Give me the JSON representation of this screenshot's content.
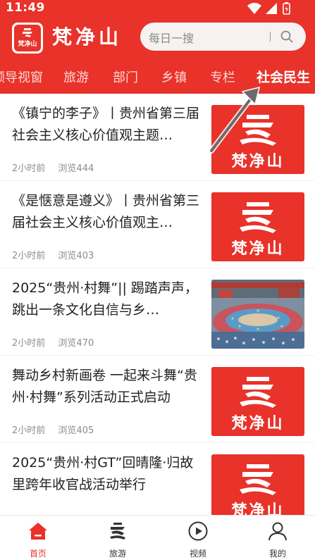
{
  "status_bar": {
    "time": "11:49"
  },
  "brand": {
    "name": "梵净山",
    "logo_text": "梵净山",
    "accent_color": "#e8322a"
  },
  "search": {
    "placeholder": "每日一搜",
    "icon": "search-icon"
  },
  "tabs": [
    {
      "label": "领导视窗",
      "active": false
    },
    {
      "label": "旅游",
      "active": false
    },
    {
      "label": "部门",
      "active": false
    },
    {
      "label": "乡镇",
      "active": false
    },
    {
      "label": "专栏",
      "active": false
    },
    {
      "label": "社会民生",
      "active": true
    }
  ],
  "articles": [
    {
      "title": "《镇宁的李子》丨贵州省第三届社会主义核心价值观主题…",
      "time": "2小时前",
      "views": "浏览444",
      "thumb": "logo"
    },
    {
      "title": "《是惬意是遵义》丨贵州省第三届社会主义核心价值观主…",
      "time": "2小时前",
      "views": "浏览403",
      "thumb": "logo"
    },
    {
      "title": "2025“贵州·村舞”|| 踢踏声声，跳出一条文化自信与乡…",
      "time": "2小时前",
      "views": "浏览470",
      "thumb": "photo"
    },
    {
      "title": "舞动乡村新画卷 一起来斗舞“贵州·村舞”系列活动正式启动",
      "time": "2小时前",
      "views": "浏览405",
      "thumb": "logo"
    },
    {
      "title": "2025“贵州·村GT”回晴隆·归故里跨年收官战活动举行",
      "time": "",
      "views": "",
      "thumb": "logo"
    }
  ],
  "thumb_logo_text": "梵净山",
  "bottom_nav": [
    {
      "label": "首页",
      "icon": "home-icon",
      "active": true
    },
    {
      "label": "旅游",
      "icon": "travel-logo-icon",
      "active": false
    },
    {
      "label": "视频",
      "icon": "play-circle-icon",
      "active": false
    },
    {
      "label": "我的",
      "icon": "user-icon",
      "active": false
    }
  ]
}
